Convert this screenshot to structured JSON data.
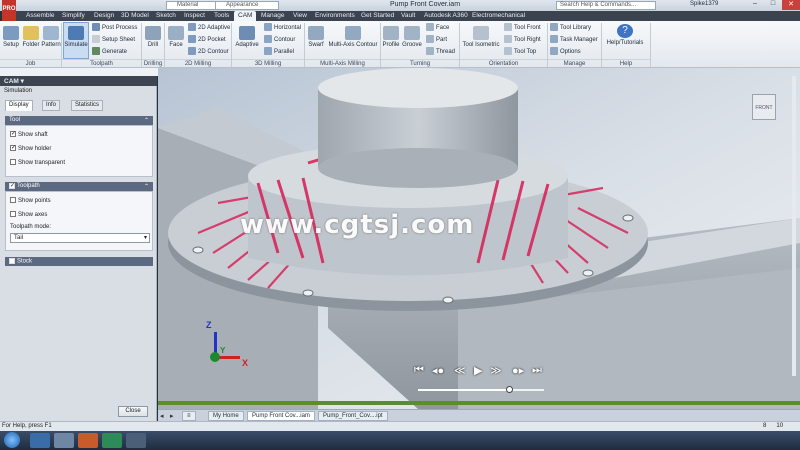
{
  "titlebar": {
    "app_logo": "PRO",
    "material": "Material",
    "appearance": "Appearance",
    "document_title": "Pump Front Cover.iam",
    "search_placeholder": "Search Help & Commands...",
    "user": "Spike1379"
  },
  "menu_tabs": [
    "Assemble",
    "Simplify",
    "Design",
    "3D Model",
    "Sketch",
    "Inspect",
    "Tools",
    "CAM",
    "Manage",
    "View",
    "Environments",
    "Get Started",
    "Vault",
    "Autodesk A360",
    "Electromechanical"
  ],
  "ribbon": {
    "job": {
      "setup": "Setup",
      "folder": "Folder",
      "pattern": "Pattern",
      "group": "Job"
    },
    "toolpath": {
      "simulate": "Simulate",
      "post_process": "Post Process",
      "setup_sheet": "Setup Sheet",
      "generate": "Generate",
      "group": "Toolpath"
    },
    "drilling": {
      "drill": "Drill",
      "group": "Drilling"
    },
    "milling2d": {
      "face": "Face",
      "adaptive2d": "2D Adaptive",
      "pocket2d": "2D Pocket",
      "contour2d": "2D Contour",
      "group": "2D Milling"
    },
    "milling3d": {
      "adaptive": "Adaptive",
      "horizontal": "Horizontal",
      "contour": "Contour",
      "parallel": "Parallel",
      "group": "3D Milling"
    },
    "multiaxis": {
      "swarf": "Swarf",
      "multiaxis_contour": "Multi-Axis Contour",
      "group": "Multi-Axis Milling"
    },
    "turning": {
      "profile": "Profile",
      "groove": "Groove",
      "face": "Face",
      "part": "Part",
      "thread": "Thread",
      "group": "Turning"
    },
    "orientation": {
      "tool_isometric": "Tool Isometric",
      "tool_front": "Tool Front",
      "tool_right": "Tool Right",
      "tool_top": "Tool Top",
      "group": "Orientation"
    },
    "manage": {
      "tool_library": "Tool Library",
      "task_manager": "Task Manager",
      "options": "Options",
      "group": "Manage"
    },
    "help": {
      "help_tutorials": "Help/Tutorials",
      "group": "Help"
    }
  },
  "panel": {
    "header": "CAM ▾",
    "subtitle": "Simulation",
    "tabs": [
      "Display",
      "Info",
      "Statistics"
    ],
    "tool_section": {
      "title": "Tool",
      "show_shaft": "Show shaft",
      "show_holder": "Show holder",
      "show_transparent": "Show transparent"
    },
    "toolpath_section": {
      "title": "Toolpath",
      "show_points": "Show points",
      "show_axes": "Show axes",
      "mode_label": "Toolpath mode:",
      "mode_value": "Tail"
    },
    "stock_section": {
      "title": "Stock"
    },
    "close": "Close"
  },
  "checkbox_state": {
    "show_shaft": true,
    "show_holder": true,
    "show_transparent": false,
    "toolpath": true,
    "show_points": false,
    "show_axes": false,
    "stock": false
  },
  "viewcube_label": "FRONT",
  "watermark": "www.cgtsj.com",
  "playback": {
    "progress": 0.72
  },
  "doc_tabs": [
    "My Home",
    "Pump Front Cov...iam",
    "Pump_Front_Cov....ipt"
  ],
  "status": {
    "text": "For Help, press F1",
    "count_a": "8",
    "count_b": "10"
  },
  "colors": {
    "toolpath_red": "#d8265a",
    "ribbon_accent": "#3e4552",
    "background": "#2b3038"
  }
}
